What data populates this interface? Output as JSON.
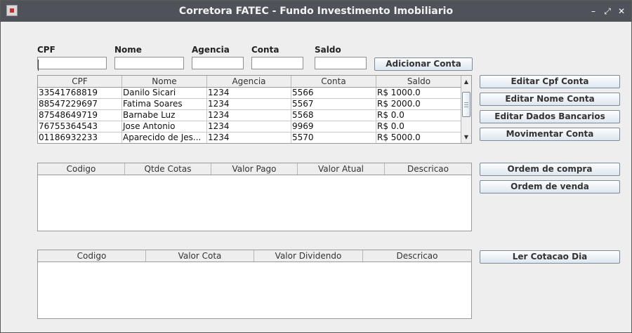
{
  "window": {
    "title": "Corretora FATEC - Fundo Investimento Imobiliario"
  },
  "window_controls": {
    "minimize": "–",
    "maximize": "⤢",
    "close": "✕"
  },
  "form": {
    "cpf_label": "CPF",
    "nome_label": "Nome",
    "agencia_label": "Agencia",
    "conta_label": "Conta",
    "saldo_label": "Saldo",
    "cpf_value": "",
    "nome_value": "",
    "agencia_value": "",
    "conta_value": "",
    "saldo_value": "",
    "add_button": "Adicionar Conta"
  },
  "accounts_table": {
    "headers": [
      "CPF",
      "Nome",
      "Agencia",
      "Conta",
      "Saldo"
    ],
    "rows": [
      [
        "33541768819",
        "Danilo Sicari",
        "1234",
        "5566",
        "R$ 1000.0"
      ],
      [
        "88547229697",
        "Fatima Soares",
        "1234",
        "5567",
        "R$ 2000.0"
      ],
      [
        "87548649719",
        "Barnabe Luz",
        "1234",
        "5568",
        "R$ 0.0"
      ],
      [
        "76755364543",
        "Jose Antonio",
        "1234",
        "9969",
        "R$ 0.0"
      ],
      [
        "01186932233",
        "Aparecido de Jes...",
        "1234",
        "5570",
        "R$ 5000.0"
      ]
    ]
  },
  "account_buttons": {
    "edit_cpf": "Editar Cpf Conta",
    "edit_nome": "Editar Nome Conta",
    "edit_bank": "Editar Dados Bancarios",
    "move": "Movimentar Conta"
  },
  "holdings_table": {
    "headers": [
      "Codigo",
      "Qtde Cotas",
      "Valor Pago",
      "Valor Atual",
      "Descricao"
    ],
    "rows": []
  },
  "order_buttons": {
    "buy": "Ordem de compra",
    "sell": "Ordem de venda"
  },
  "quotes_table": {
    "headers": [
      "Codigo",
      "Valor Cota",
      "Valor Dividendo",
      "Descricao"
    ],
    "rows": []
  },
  "quote_button": {
    "read": "Ler Cotacao Dia"
  }
}
